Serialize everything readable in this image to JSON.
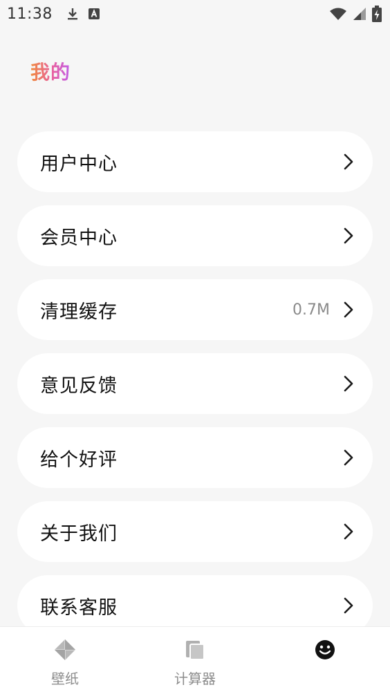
{
  "status_bar": {
    "time": "11:38",
    "icons_left": [
      "download-icon",
      "a-badge-icon"
    ],
    "icons_right": [
      "wifi-icon",
      "cell-signal-icon",
      "battery-charging-icon"
    ]
  },
  "header": {
    "title": "我的",
    "title_gradient": [
      "#f08a3c",
      "#e860a0",
      "#c05ce8"
    ]
  },
  "menu": {
    "items": [
      {
        "label": "用户中心",
        "value": ""
      },
      {
        "label": "会员中心",
        "value": ""
      },
      {
        "label": "清理缓存",
        "value": "0.7M"
      },
      {
        "label": "意见反馈",
        "value": ""
      },
      {
        "label": "给个好评",
        "value": ""
      },
      {
        "label": "关于我们",
        "value": ""
      },
      {
        "label": "联系客服",
        "value": ""
      }
    ],
    "chevron_icon": "chevron-right-icon"
  },
  "bottom_nav": {
    "tabs": [
      {
        "label": "壁纸",
        "icon": "diamond-icon",
        "active": false
      },
      {
        "label": "计算器",
        "icon": "cards-icon",
        "active": false
      },
      {
        "label": "",
        "icon": "smiley-icon",
        "active": true
      }
    ],
    "active_color": "#111111",
    "inactive_color": "#b0b0b0"
  }
}
